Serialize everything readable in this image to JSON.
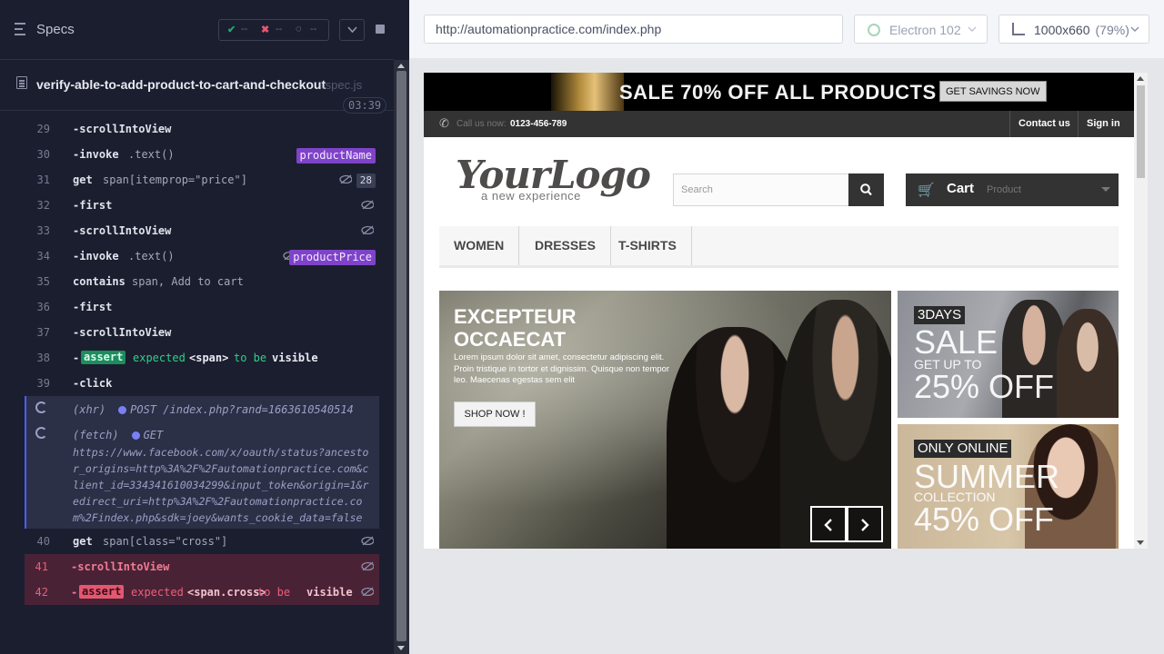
{
  "specs_header": {
    "title": "Specs",
    "stats": {
      "passed": "--",
      "failed": "--",
      "pending": "--"
    }
  },
  "spec_file": {
    "name": "verify-able-to-add-product-to-cart-and-checkout",
    "ext": ".spec.js",
    "timer": "03:39"
  },
  "commands": [
    {
      "num": "29",
      "name": "-scrollIntoView"
    },
    {
      "num": "30",
      "name": "-invoke",
      "arg": ".text()",
      "alias": "productName"
    },
    {
      "num": "31",
      "name": "get",
      "arg": "span[itemprop=\"price\"]",
      "count": "28"
    },
    {
      "num": "32",
      "name": "-first"
    },
    {
      "num": "33",
      "name": "-scrollIntoView"
    },
    {
      "num": "34",
      "name": "-invoke",
      "arg": ".text()",
      "alias": "productPrice"
    },
    {
      "num": "35",
      "name": "contains",
      "arg": "span, Add to cart"
    },
    {
      "num": "36",
      "name": "-first"
    },
    {
      "num": "37",
      "name": "-scrollIntoView"
    },
    {
      "num": "38",
      "name": "-",
      "badge": "assert",
      "words": [
        "expected",
        "<span>",
        "to be",
        "visible"
      ]
    },
    {
      "num": "39",
      "name": "-click"
    }
  ],
  "xhr": {
    "type": "(xhr)",
    "method": "POST",
    "path": "/index.php?rand=1663610540514",
    "fetch_type": "(fetch)",
    "fetch_method": "GET",
    "fetch_url": "https://www.facebook.com/x/oauth/status?ancestor_origins=http%3A%2F%2Fautomationpractice.com&client_id=334341610034299&input_token&origin=1&redirect_uri=http%3A%2F%2Fautomationpractice.com%2Findex.php&sdk=joey&wants_cookie_data=false"
  },
  "commands_after": [
    {
      "num": "40",
      "name": "get",
      "arg": "span[class=\"cross\"]"
    },
    {
      "num": "41",
      "name": "-scrollIntoView",
      "failed": true
    },
    {
      "num": "42",
      "name": "-",
      "badge": "assert",
      "words": [
        "expected",
        "<span.cross>",
        "to be",
        "visible"
      ],
      "failed": true
    }
  ],
  "browser_bar": {
    "url": "http://automationpractice.com/index.php",
    "browser": "Electron 102",
    "viewport": "1000x660",
    "zoom": "(79%)"
  },
  "site": {
    "banner_text": "SALE 70% OFF ALL PRODUCTS",
    "banner_button": "GET SAVINGS NOW",
    "call_label": "Call us now:",
    "call_number": "0123-456-789",
    "contact": "Contact us",
    "signin": "Sign in",
    "logo": "YourLogo",
    "logo_sub": "a new experience",
    "search_placeholder": "Search",
    "cart_label": "Cart",
    "cart_product": "Product",
    "menu": [
      "WOMEN",
      "DRESSES",
      "T-SHIRTS"
    ],
    "slide_title": "EXCEPTEUR OCCAECAT",
    "slide_text": "Lorem ipsum dolor sit amet, consectetur adipiscing elit. Proin tristique in tortor et dignissim. Quisque non tempor leo. Maecenas egestas sem elit",
    "shop_now": "SHOP NOW !",
    "promo1": {
      "tag": "3DAYS",
      "big1": "SALE",
      "small": "GET UP TO",
      "big2": "25% OFF"
    },
    "promo2": {
      "tag": "ONLY ONLINE",
      "big1": "SUMMER",
      "small": "COLLECTION",
      "big2": "45% OFF"
    }
  },
  "colors": {
    "alias_badge": "#7f43c9",
    "assert_pass": "#1d8c5f",
    "assert_fail": "#e45770",
    "xhr_indicator": "#4b5ef7"
  }
}
